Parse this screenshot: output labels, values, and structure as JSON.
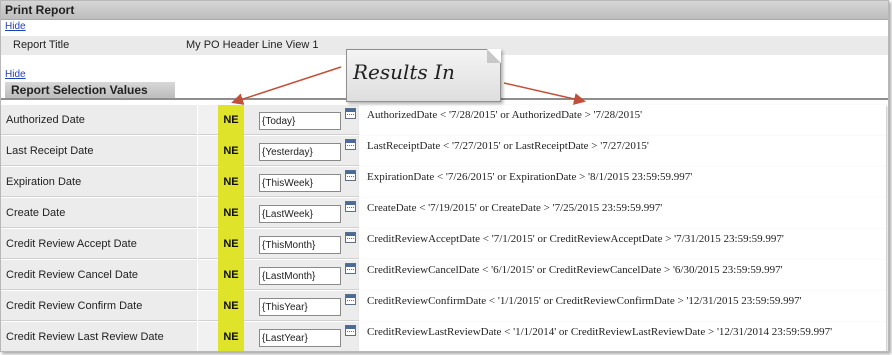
{
  "window": {
    "title": "Print Report"
  },
  "links": {
    "hide_top": "Hide",
    "hide_bottom": "Hide"
  },
  "report_title": {
    "label": "Report Title",
    "value": "My PO Header Line View 1"
  },
  "selection_header": "Report Selection Values",
  "callout": {
    "text": "Results In"
  },
  "rows": [
    {
      "label": "Authorized Date",
      "operator": "NE",
      "value": "{Today}",
      "result": "AuthorizedDate < '7/28/2015'  or AuthorizedDate > '7/28/2015'"
    },
    {
      "label": "Last Receipt Date",
      "operator": "NE",
      "value": "{Yesterday}",
      "result": "LastReceiptDate < '7/27/2015'  or LastReceiptDate > '7/27/2015'"
    },
    {
      "label": "Expiration Date",
      "operator": "NE",
      "value": "{ThisWeek}",
      "result": "ExpirationDate < '7/26/2015'  or ExpirationDate > '8/1/2015 23:59:59.997'"
    },
    {
      "label": "Create Date",
      "operator": "NE",
      "value": "{LastWeek}",
      "result": "CreateDate < '7/19/2015'  or CreateDate > '7/25/2015 23:59:59.997'"
    },
    {
      "label": "Credit Review Accept Date",
      "operator": "NE",
      "value": "{ThisMonth}",
      "result": "CreditReviewAcceptDate < '7/1/2015'  or CreditReviewAcceptDate > '7/31/2015 23:59:59.997'"
    },
    {
      "label": "Credit Review Cancel Date",
      "operator": "NE",
      "value": "{LastMonth}",
      "result": "CreditReviewCancelDate < '6/1/2015'  or CreditReviewCancelDate > '6/30/2015 23:59:59.997'"
    },
    {
      "label": "Credit Review Confirm Date",
      "operator": "NE",
      "value": "{ThisYear}",
      "result": "CreditReviewConfirmDate < '1/1/2015'  or CreditReviewConfirmDate > '12/31/2015 23:59:59.997'"
    },
    {
      "label": "Credit Review Last Review Date",
      "operator": "NE",
      "value": "{LastYear}",
      "result": "CreditReviewLastReviewDate < '1/1/2014'  or CreditReviewLastReviewDate > '12/31/2014 23:59:59.997'"
    }
  ],
  "icons": {
    "calendar": "calendar-icon"
  },
  "colors": {
    "operator_highlight": "#dfe42a",
    "arrow": "#c0503a",
    "link": "#1f3fbf"
  }
}
